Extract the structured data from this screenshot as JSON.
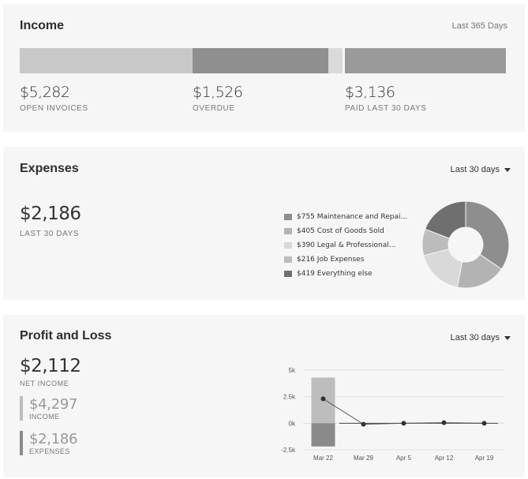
{
  "income": {
    "title": "Income",
    "period": "Last 365 Days",
    "stats": [
      {
        "amount": "$5,282",
        "label": "OPEN INVOICES",
        "color": "#c8c8c8"
      },
      {
        "amount": "$1,526",
        "label": "OVERDUE",
        "color": "#8f8f8f"
      },
      {
        "amount": "$3,136",
        "label": "PAID LAST 30 DAYS",
        "color": "#9a9a9a"
      }
    ],
    "not_deposited_color": "#dadada"
  },
  "expenses": {
    "title": "Expenses",
    "period": "Last 30 days",
    "total": "$2,186",
    "total_label": "LAST 30 DAYS",
    "categories": [
      {
        "label": "$755 Maintenance and Repai...",
        "value": 755,
        "color": "#8e8e8e"
      },
      {
        "label": "$405 Cost of Goods Sold",
        "value": 405,
        "color": "#b3b3b3"
      },
      {
        "label": "$390 Legal & Professional...",
        "value": 390,
        "color": "#d9d9d9"
      },
      {
        "label": "$216 Job Expenses",
        "value": 216,
        "color": "#bcbcbc"
      },
      {
        "label": "$419 Everything else",
        "value": 419,
        "color": "#6f6f6f"
      }
    ]
  },
  "profit_loss": {
    "title": "Profit and Loss",
    "period": "Last 30 days",
    "net": "$2,112",
    "net_label": "NET INCOME",
    "income": "$4,297",
    "income_label": "INCOME",
    "expenses": "$2,186",
    "expenses_label": "EXPENSES",
    "income_color": "#bdbdbd",
    "expenses_color": "#8a8a8a"
  },
  "chart_data": {
    "type": "line",
    "x": [
      "Mar 22",
      "Mar 29",
      "Apr 5",
      "Apr 12",
      "Apr 19"
    ],
    "y_ticks": [
      "5k",
      "2.5k",
      "0k",
      "-2.5k"
    ],
    "ylim": [
      -2500,
      5000
    ],
    "series": [
      {
        "values": [
          2300,
          -100,
          0,
          50,
          0
        ]
      }
    ],
    "bars": {
      "income": 4297,
      "expenses": -2186
    }
  }
}
